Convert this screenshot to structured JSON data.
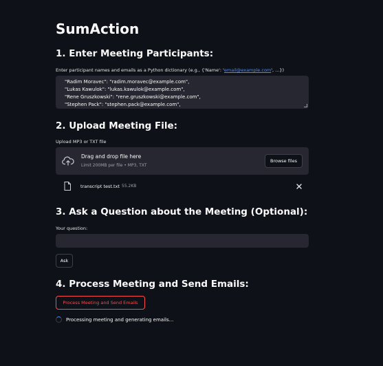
{
  "app": {
    "title": "SumAction"
  },
  "section1": {
    "heading": "1. Enter Meeting Participants:",
    "instruction_prefix": "Enter participant names and emails as a Python dictionary (e.g., {'Name': '",
    "instruction_link": "email@example.com",
    "instruction_suffix": "', ...})",
    "textarea_lines": [
      "\"Radim Moravec\": \"radim.moravec@example.com\",",
      "\"Lukas Kawulok\": \"lukas.kawulok@example.com\",",
      "\"Rene Gruszkowski\": \"rene.gruszkowski@example.com\",",
      "\"Stephen Pack\": \"stephen.pack@example.com\","
    ]
  },
  "section2": {
    "heading": "2. Upload Meeting File:",
    "label": "Upload MP3 or TXT file",
    "dropzone_main": "Drag and drop file here",
    "dropzone_sub": "Limit 200MB per file • MP3, TXT",
    "browse_label": "Browse files",
    "file_name": "transcript test.txt",
    "file_size": "55.2KB"
  },
  "section3": {
    "heading": "3. Ask a Question about the Meeting (Optional):",
    "label": "Your question:",
    "input_value": "",
    "ask_label": "Ask"
  },
  "section4": {
    "heading": "4. Process Meeting and Send Emails:",
    "button_label": "Process Meeting and Send Emails",
    "status": "Processing meeting and generating emails..."
  },
  "icons": {
    "upload": "cloud-upload-icon",
    "file": "file-icon",
    "close": "close-icon",
    "spinner": "spinner-icon"
  },
  "colors": {
    "background": "#0e1117",
    "input_background": "#262730",
    "accent": "#ff4b4b",
    "link": "#4f8dff"
  }
}
